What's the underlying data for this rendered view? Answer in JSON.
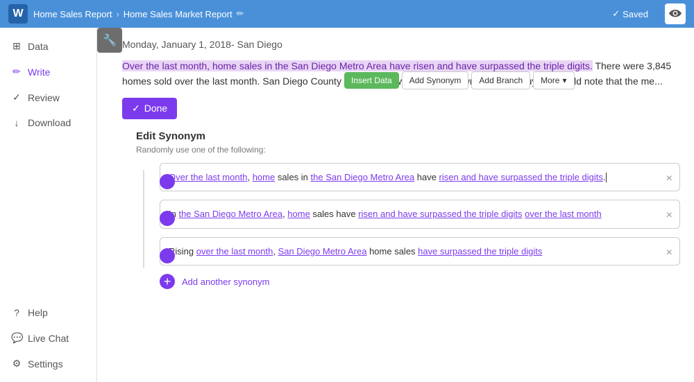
{
  "header": {
    "logo": "W",
    "breadcrumb1": "Home Sales Report",
    "breadcrumb2": "Home Sales Market Report",
    "saved_label": "Saved"
  },
  "sidebar": {
    "items": [
      {
        "id": "data",
        "label": "Data",
        "icon": "⊞"
      },
      {
        "id": "write",
        "label": "Write",
        "icon": "✏"
      },
      {
        "id": "review",
        "label": "Review",
        "icon": "✓"
      },
      {
        "id": "download",
        "label": "Download",
        "icon": "↓"
      }
    ],
    "bottom_items": [
      {
        "id": "help",
        "label": "Help",
        "icon": "?"
      },
      {
        "id": "live-chat",
        "label": "Live Chat",
        "icon": "💬"
      },
      {
        "id": "settings",
        "label": "Settings",
        "icon": "⚙"
      }
    ]
  },
  "toolbar": {
    "done_label": "Done",
    "insert_data_label": "Insert Data",
    "add_synonym_label": "Add Synonym",
    "add_branch_label": "Add Branch",
    "more_label": "More"
  },
  "main": {
    "date_line": "Monday, January 1, 2018- San Diego",
    "article_highlighted": "Over the last month, home sales in the San Diego Metro Area have risen and have surpassed the triple digits.",
    "article_rest": " There were 3,845 homes sold over the last month. San Diego County led the way, with 1,678 its own. Potential buyers should note that the me...",
    "edit_synonym_title": "Edit Synonym",
    "edit_synonym_subtitle": "Randomly use one of the following:",
    "synonyms": [
      {
        "id": 1,
        "parts": [
          {
            "text": "Over the last month",
            "type": "link"
          },
          {
            "text": ", ",
            "type": "plain"
          },
          {
            "text": "home",
            "type": "link"
          },
          {
            "text": " sales in ",
            "type": "plain"
          },
          {
            "text": "the San Diego Metro Area",
            "type": "link"
          },
          {
            "text": " have ",
            "type": "plain"
          },
          {
            "text": "risen and have surpassed the triple digits",
            "type": "link"
          },
          {
            "text": ".",
            "type": "plain"
          }
        ]
      },
      {
        "id": 2,
        "parts": [
          {
            "text": "In ",
            "type": "plain"
          },
          {
            "text": "the San Diego Metro Area",
            "type": "link"
          },
          {
            "text": ", ",
            "type": "plain"
          },
          {
            "text": "home",
            "type": "link"
          },
          {
            "text": " sales have ",
            "type": "plain"
          },
          {
            "text": "risen and have surpassed the triple digits",
            "type": "link"
          },
          {
            "text": " ",
            "type": "plain"
          },
          {
            "text": "over the last month",
            "type": "link"
          }
        ]
      },
      {
        "id": 3,
        "parts": [
          {
            "text": "Rising ",
            "type": "plain"
          },
          {
            "text": "over the last month",
            "type": "link"
          },
          {
            "text": ", ",
            "type": "plain"
          },
          {
            "text": "San Diego Metro Area",
            "type": "link"
          },
          {
            "text": " ",
            "type": "plain"
          },
          {
            "text": "home",
            "type": "plain"
          },
          {
            "text": " sales ",
            "type": "plain"
          },
          {
            "text": "have surpassed the triple digits",
            "type": "link"
          }
        ]
      }
    ],
    "add_synonym_label": "Add another synonym"
  }
}
